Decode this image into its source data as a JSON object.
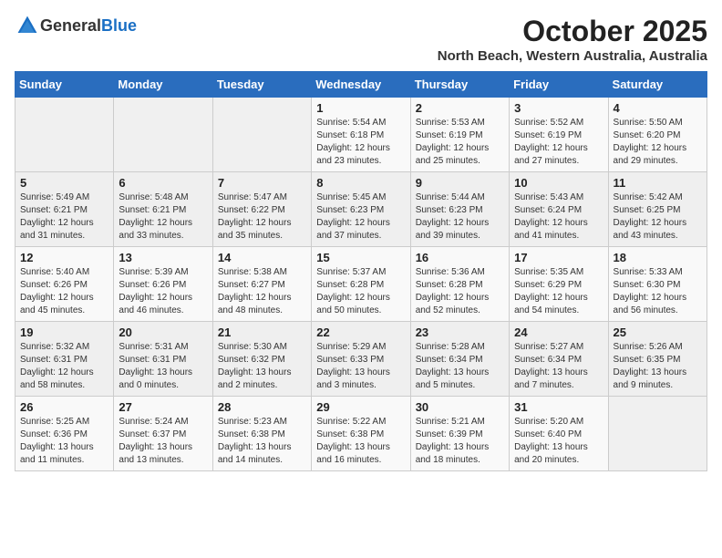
{
  "logo": {
    "general": "General",
    "blue": "Blue"
  },
  "header": {
    "title": "October 2025",
    "subtitle": "North Beach, Western Australia, Australia"
  },
  "weekdays": [
    "Sunday",
    "Monday",
    "Tuesday",
    "Wednesday",
    "Thursday",
    "Friday",
    "Saturday"
  ],
  "weeks": [
    [
      {
        "day": "",
        "info": ""
      },
      {
        "day": "",
        "info": ""
      },
      {
        "day": "",
        "info": ""
      },
      {
        "day": "1",
        "info": "Sunrise: 5:54 AM\nSunset: 6:18 PM\nDaylight: 12 hours\nand 23 minutes."
      },
      {
        "day": "2",
        "info": "Sunrise: 5:53 AM\nSunset: 6:19 PM\nDaylight: 12 hours\nand 25 minutes."
      },
      {
        "day": "3",
        "info": "Sunrise: 5:52 AM\nSunset: 6:19 PM\nDaylight: 12 hours\nand 27 minutes."
      },
      {
        "day": "4",
        "info": "Sunrise: 5:50 AM\nSunset: 6:20 PM\nDaylight: 12 hours\nand 29 minutes."
      }
    ],
    [
      {
        "day": "5",
        "info": "Sunrise: 5:49 AM\nSunset: 6:21 PM\nDaylight: 12 hours\nand 31 minutes."
      },
      {
        "day": "6",
        "info": "Sunrise: 5:48 AM\nSunset: 6:21 PM\nDaylight: 12 hours\nand 33 minutes."
      },
      {
        "day": "7",
        "info": "Sunrise: 5:47 AM\nSunset: 6:22 PM\nDaylight: 12 hours\nand 35 minutes."
      },
      {
        "day": "8",
        "info": "Sunrise: 5:45 AM\nSunset: 6:23 PM\nDaylight: 12 hours\nand 37 minutes."
      },
      {
        "day": "9",
        "info": "Sunrise: 5:44 AM\nSunset: 6:23 PM\nDaylight: 12 hours\nand 39 minutes."
      },
      {
        "day": "10",
        "info": "Sunrise: 5:43 AM\nSunset: 6:24 PM\nDaylight: 12 hours\nand 41 minutes."
      },
      {
        "day": "11",
        "info": "Sunrise: 5:42 AM\nSunset: 6:25 PM\nDaylight: 12 hours\nand 43 minutes."
      }
    ],
    [
      {
        "day": "12",
        "info": "Sunrise: 5:40 AM\nSunset: 6:26 PM\nDaylight: 12 hours\nand 45 minutes."
      },
      {
        "day": "13",
        "info": "Sunrise: 5:39 AM\nSunset: 6:26 PM\nDaylight: 12 hours\nand 46 minutes."
      },
      {
        "day": "14",
        "info": "Sunrise: 5:38 AM\nSunset: 6:27 PM\nDaylight: 12 hours\nand 48 minutes."
      },
      {
        "day": "15",
        "info": "Sunrise: 5:37 AM\nSunset: 6:28 PM\nDaylight: 12 hours\nand 50 minutes."
      },
      {
        "day": "16",
        "info": "Sunrise: 5:36 AM\nSunset: 6:28 PM\nDaylight: 12 hours\nand 52 minutes."
      },
      {
        "day": "17",
        "info": "Sunrise: 5:35 AM\nSunset: 6:29 PM\nDaylight: 12 hours\nand 54 minutes."
      },
      {
        "day": "18",
        "info": "Sunrise: 5:33 AM\nSunset: 6:30 PM\nDaylight: 12 hours\nand 56 minutes."
      }
    ],
    [
      {
        "day": "19",
        "info": "Sunrise: 5:32 AM\nSunset: 6:31 PM\nDaylight: 12 hours\nand 58 minutes."
      },
      {
        "day": "20",
        "info": "Sunrise: 5:31 AM\nSunset: 6:31 PM\nDaylight: 13 hours\nand 0 minutes."
      },
      {
        "day": "21",
        "info": "Sunrise: 5:30 AM\nSunset: 6:32 PM\nDaylight: 13 hours\nand 2 minutes."
      },
      {
        "day": "22",
        "info": "Sunrise: 5:29 AM\nSunset: 6:33 PM\nDaylight: 13 hours\nand 3 minutes."
      },
      {
        "day": "23",
        "info": "Sunrise: 5:28 AM\nSunset: 6:34 PM\nDaylight: 13 hours\nand 5 minutes."
      },
      {
        "day": "24",
        "info": "Sunrise: 5:27 AM\nSunset: 6:34 PM\nDaylight: 13 hours\nand 7 minutes."
      },
      {
        "day": "25",
        "info": "Sunrise: 5:26 AM\nSunset: 6:35 PM\nDaylight: 13 hours\nand 9 minutes."
      }
    ],
    [
      {
        "day": "26",
        "info": "Sunrise: 5:25 AM\nSunset: 6:36 PM\nDaylight: 13 hours\nand 11 minutes."
      },
      {
        "day": "27",
        "info": "Sunrise: 5:24 AM\nSunset: 6:37 PM\nDaylight: 13 hours\nand 13 minutes."
      },
      {
        "day": "28",
        "info": "Sunrise: 5:23 AM\nSunset: 6:38 PM\nDaylight: 13 hours\nand 14 minutes."
      },
      {
        "day": "29",
        "info": "Sunrise: 5:22 AM\nSunset: 6:38 PM\nDaylight: 13 hours\nand 16 minutes."
      },
      {
        "day": "30",
        "info": "Sunrise: 5:21 AM\nSunset: 6:39 PM\nDaylight: 13 hours\nand 18 minutes."
      },
      {
        "day": "31",
        "info": "Sunrise: 5:20 AM\nSunset: 6:40 PM\nDaylight: 13 hours\nand 20 minutes."
      },
      {
        "day": "",
        "info": ""
      }
    ]
  ]
}
